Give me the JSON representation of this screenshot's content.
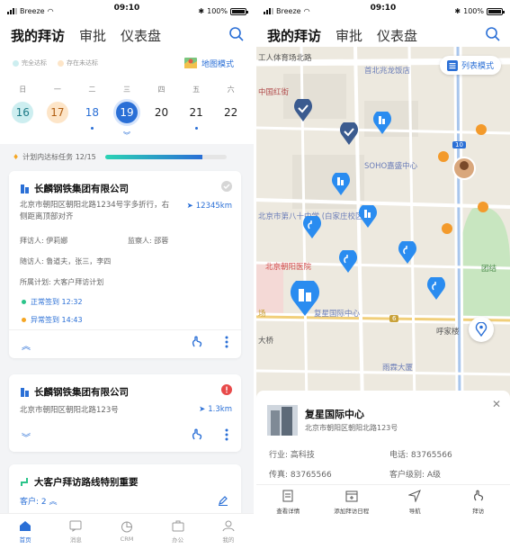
{
  "status": {
    "carrier": "Breeze",
    "time": "09:10",
    "battery": "100%"
  },
  "nav": {
    "tab_visits": "我的拜访",
    "tab_approval": "审批",
    "tab_dashboard": "仪表盘"
  },
  "legend": {
    "done": "完全达标",
    "pending": "存在未达标",
    "map_mode": "地图模式",
    "done_color": "#cdeef0",
    "pending_color": "#fde5c8"
  },
  "calendar": {
    "weekdays": [
      "日",
      "一",
      "二",
      "三",
      "四",
      "五",
      "六"
    ],
    "dates": [
      "16",
      "17",
      "18",
      "19",
      "20",
      "21",
      "22"
    ],
    "selected": "19"
  },
  "progress": {
    "label": "计划内达标任务 12/15",
    "fraction": 0.8
  },
  "card1": {
    "company": "长麟钢铁集团有限公司",
    "address": "北京市朝阳区朝阳北路1234号字多折行，右侧距离顶部对齐",
    "distance": "12345km",
    "visitor": "拜访人: 伊莉娜",
    "supervisor": "监察人: 邵蓉",
    "companions": "随访人: 鲁道夫，张三，李四",
    "plan": "所属计划: 大客户拜访计划",
    "checkin_normal": "正常签到 12:32",
    "checkin_abnormal": "异常签到 14:43"
  },
  "card2": {
    "company": "长麟钢铁集团有限公司",
    "address": "北京市朝阳区朝阳北路123号",
    "distance": "1.3km"
  },
  "card3": {
    "route": "大客户拜访路线特别重要",
    "customers": "客户: 2"
  },
  "bottomnav": {
    "home": "首页",
    "messages": "消息",
    "crm": "CRM",
    "office": "办公",
    "mine": "我的"
  },
  "map": {
    "list_mode": "列表模式",
    "labels": {
      "road1": "工人体育场北路",
      "hotel": "首北兆龙饭店",
      "redstar": "中国红街",
      "soho": "SOHO嘉盛中心",
      "school": "北京市第八十中学 (白家庄校区)",
      "hospital": "北京朝阳医院",
      "fuxing": "复星国际中心",
      "bridge": "大桥",
      "hujia": "呼家楼",
      "yuxing": "雨霖大厦",
      "tuanjie": "团结",
      "field": "场",
      "road10": "10",
      "road6": "6"
    }
  },
  "sheet": {
    "name": "复星国际中心",
    "address": "北京市朝阳区朝阳北路123号",
    "industry": "行业: 高科技",
    "phone": "电话: 83765566",
    "fax": "传真: 83765566",
    "level": "客户级别: A级",
    "actions": [
      "查看详情",
      "添加拜访日程",
      "导航",
      "拜访"
    ]
  }
}
